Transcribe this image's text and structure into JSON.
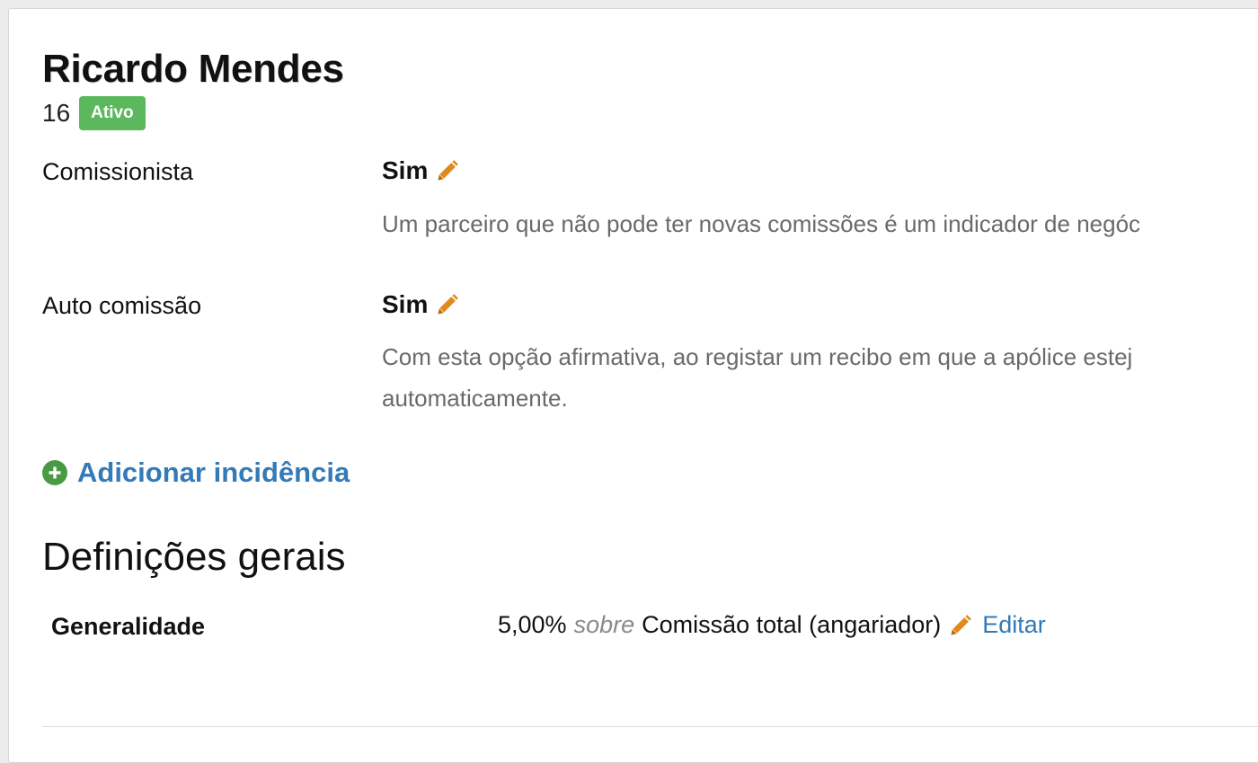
{
  "partner": {
    "name": "Ricardo Mendes",
    "id": "16",
    "status": "Ativo",
    "status_color": "#5cb85c"
  },
  "rows": [
    {
      "label": "Comissionista",
      "value": "Sim",
      "description": "Um parceiro que não pode ter novas comissões é um indicador de negóc"
    },
    {
      "label": "Auto comissão",
      "value": "Sim",
      "description_line1": "Com esta opção afirmativa, ao registar um recibo em que a apólice estej",
      "description_line2": "automaticamente."
    }
  ],
  "add_incidence": {
    "label": "Adicionar incidência",
    "icon": "plus-circle-icon",
    "icon_color": "#4a9a45"
  },
  "general_settings": {
    "title": "Definições gerais",
    "rows": [
      {
        "label": "Generalidade",
        "percent": "5,00%",
        "connector": "sobre",
        "base": "Comissão total (angariador)",
        "edit_label": "Editar"
      }
    ]
  },
  "colors": {
    "link": "#337ab7",
    "pencil": "#e08a1e",
    "muted_text": "#6a6a6a"
  }
}
